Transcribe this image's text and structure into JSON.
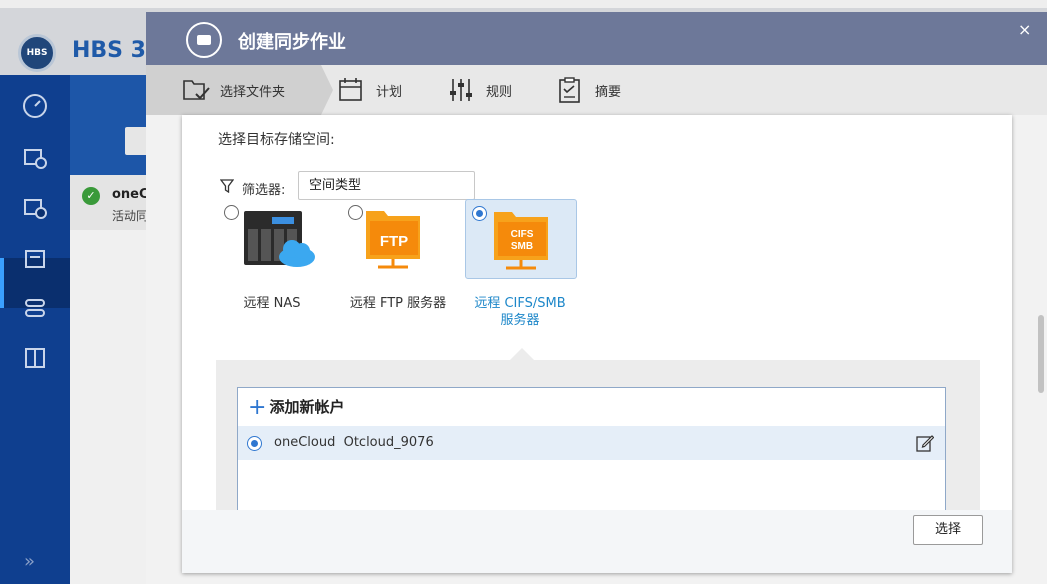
{
  "app": {
    "logo_text": "HBS",
    "title": "HBS 3"
  },
  "background_job": {
    "name": "oneC",
    "status": "活动同"
  },
  "dialog": {
    "title": "创建同步作业",
    "close_icon": "×",
    "steps": [
      {
        "label": "选择文件夹",
        "icon": "folder-select-icon",
        "active": true
      },
      {
        "label": "计划",
        "icon": "calendar-icon",
        "active": false
      },
      {
        "label": "规则",
        "icon": "sliders-icon",
        "active": false
      },
      {
        "label": "摘要",
        "icon": "clipboard-icon",
        "active": false
      }
    ],
    "target_label": "选择目标存储空间:",
    "filter": {
      "label": "筛选器:",
      "value": "空间类型"
    },
    "options": [
      {
        "label": "远程 NAS",
        "selected": false
      },
      {
        "label": "远程 FTP 服务器",
        "badge": "FTP",
        "selected": false
      },
      {
        "label_line1": "远程 CIFS/SMB",
        "label_line2": "服务器",
        "badge1": "CIFS",
        "badge2": "SMB",
        "selected": true
      }
    ],
    "add_account": "添加新帐户",
    "accounts": [
      {
        "service": "oneCloud",
        "name": "Otcloud_9076",
        "selected": true
      }
    ],
    "select_button": "选择"
  },
  "colors": {
    "header": "#6d7899",
    "accent": "#2f77d0",
    "selected_label": "#1d87c9",
    "sidebar": "#0f3f8f"
  }
}
